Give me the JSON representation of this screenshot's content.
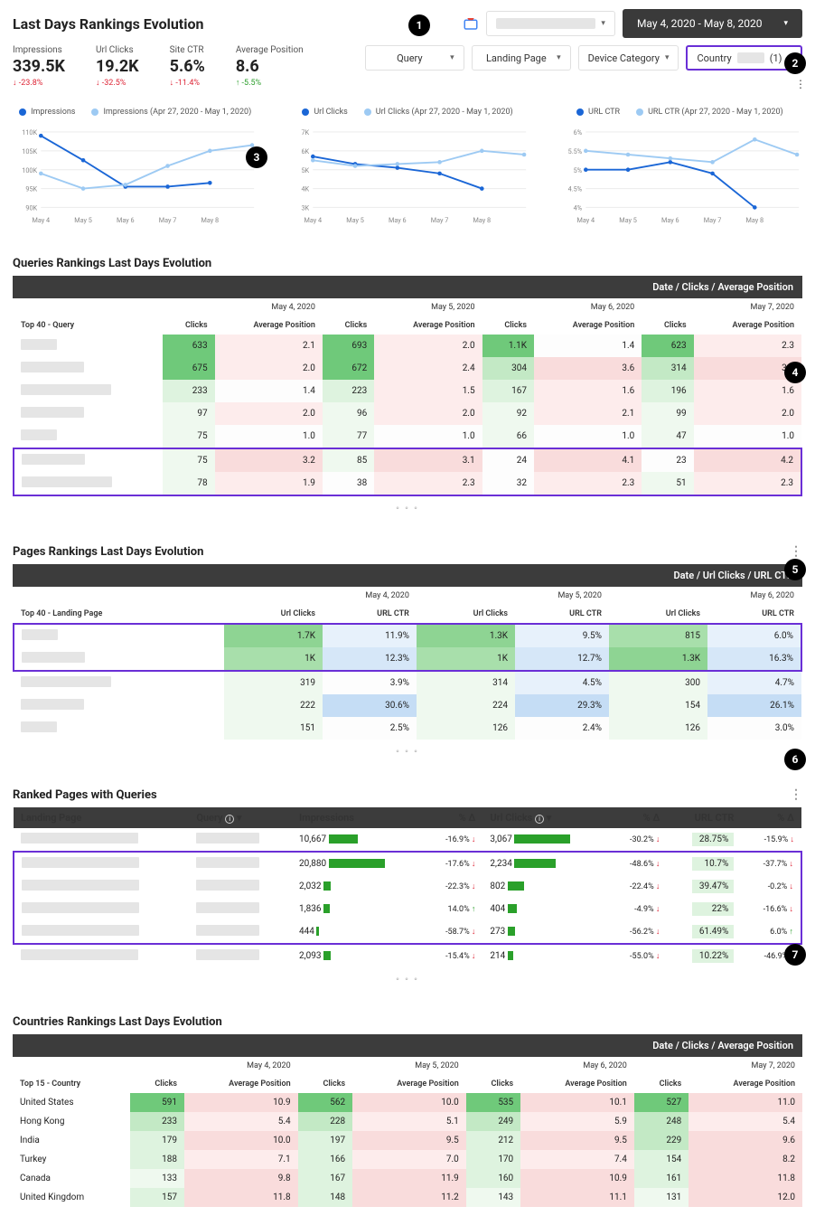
{
  "title": "Last Days Rankings Evolution",
  "dateRange": "May 4, 2020 - May 8, 2020",
  "metrics": [
    {
      "label": "Impressions",
      "value": "339.5K",
      "delta": "-23.8%",
      "dir": "down"
    },
    {
      "label": "Url Clicks",
      "value": "19.2K",
      "delta": "-32.5%",
      "dir": "down"
    },
    {
      "label": "Site CTR",
      "value": "5.6%",
      "delta": "-11.4%",
      "dir": "down"
    },
    {
      "label": "Average Position",
      "value": "8.6",
      "delta": "-5.5%",
      "dir": "up"
    }
  ],
  "filters": {
    "query": "Query",
    "landing": "Landing Page",
    "device": "Device Category",
    "country": "Country",
    "countryCount": "(1)"
  },
  "chart_data": [
    {
      "type": "line",
      "series": [
        {
          "name": "Impressions",
          "color": "#1a66d6",
          "values": [
            109000,
            102500,
            95500,
            95500,
            96500,
            null
          ]
        },
        {
          "name": "Impressions (Apr 27, 2020 - May 1, 2020)",
          "color": "#9dcaf3",
          "values": [
            99000,
            95000,
            96000,
            101000,
            105000,
            106500
          ]
        }
      ],
      "categories": [
        "May 4",
        "May 5",
        "May 6",
        "May 7",
        "May 8",
        ""
      ],
      "ylim": [
        90000,
        110000
      ],
      "yticks": [
        "90K",
        "95K",
        "100K",
        "105K",
        "110K"
      ]
    },
    {
      "type": "line",
      "series": [
        {
          "name": "Url Clicks",
          "color": "#1a66d6",
          "values": [
            5700,
            5300,
            5100,
            4800,
            4000,
            null
          ]
        },
        {
          "name": "Url Clicks (Apr 27, 2020 - May 1, 2020)",
          "color": "#9dcaf3",
          "values": [
            5500,
            5200,
            5300,
            5400,
            6000,
            5800
          ]
        }
      ],
      "categories": [
        "May 4",
        "May 5",
        "May 6",
        "May 7",
        "May 8",
        ""
      ],
      "ylim": [
        3000,
        7000
      ],
      "yticks": [
        "3K",
        "4K",
        "5K",
        "6K",
        "7K"
      ]
    },
    {
      "type": "line",
      "series": [
        {
          "name": "URL CTR",
          "color": "#1a66d6",
          "values": [
            5.0,
            5.0,
            5.2,
            4.9,
            4.0,
            null
          ]
        },
        {
          "name": "URL CTR (Apr 27, 2020 - May 1, 2020)",
          "color": "#9dcaf3",
          "values": [
            5.5,
            5.4,
            5.3,
            5.2,
            5.8,
            5.4
          ]
        }
      ],
      "categories": [
        "May 4",
        "May 5",
        "May 6",
        "May 7",
        "May 8",
        ""
      ],
      "ylim": [
        4,
        6
      ],
      "yticks": [
        "4%",
        "4.5%",
        "5%",
        "5.5%",
        "6%"
      ]
    }
  ],
  "queriesSection": {
    "title": "Queries Rankings Last Days Evolution",
    "band": "Date / Clicks / Average Position",
    "dates": [
      "May 4, 2020",
      "May 5, 2020",
      "May 6, 2020",
      "May 7, 2020"
    ],
    "rowlabel": "Top 40 - Query",
    "cols": [
      "Clicks",
      "Average Position"
    ],
    "rows": [
      {
        "c": [
          {
            "v": "633",
            "cls": "cell-g1"
          },
          {
            "v": "2.1",
            "cls": "cell-r1"
          },
          {
            "v": "693",
            "cls": "cell-g1"
          },
          {
            "v": "2.0",
            "cls": "cell-r1"
          },
          {
            "v": "1.1K",
            "cls": "cell-g1"
          },
          {
            "v": "1.4",
            "cls": "cell-w"
          },
          {
            "v": "623",
            "cls": "cell-g1"
          },
          {
            "v": "2.3",
            "cls": "cell-r1"
          }
        ]
      },
      {
        "c": [
          {
            "v": "675",
            "cls": "cell-g1"
          },
          {
            "v": "2.0",
            "cls": "cell-r1"
          },
          {
            "v": "672",
            "cls": "cell-g1"
          },
          {
            "v": "2.4",
            "cls": "cell-r1"
          },
          {
            "v": "304",
            "cls": "cell-g4"
          },
          {
            "v": "3.6",
            "cls": "cell-r2"
          },
          {
            "v": "314",
            "cls": "cell-g4"
          },
          {
            "v": "3.5",
            "cls": "cell-r2"
          }
        ]
      },
      {
        "c": [
          {
            "v": "233",
            "cls": "cell-g5"
          },
          {
            "v": "1.4",
            "cls": "cell-w"
          },
          {
            "v": "223",
            "cls": "cell-g5"
          },
          {
            "v": "1.5",
            "cls": "cell-r1"
          },
          {
            "v": "167",
            "cls": "cell-g5"
          },
          {
            "v": "1.6",
            "cls": "cell-r1"
          },
          {
            "v": "196",
            "cls": "cell-g5"
          },
          {
            "v": "1.6",
            "cls": "cell-r1"
          }
        ]
      },
      {
        "c": [
          {
            "v": "97",
            "cls": "cell-g6"
          },
          {
            "v": "2.0",
            "cls": "cell-r1"
          },
          {
            "v": "96",
            "cls": "cell-g6"
          },
          {
            "v": "2.0",
            "cls": "cell-r1"
          },
          {
            "v": "92",
            "cls": "cell-g6"
          },
          {
            "v": "2.1",
            "cls": "cell-r1"
          },
          {
            "v": "99",
            "cls": "cell-g6"
          },
          {
            "v": "2.0",
            "cls": "cell-r1"
          }
        ]
      },
      {
        "c": [
          {
            "v": "75",
            "cls": "cell-g6"
          },
          {
            "v": "1.0",
            "cls": "cell-w"
          },
          {
            "v": "77",
            "cls": "cell-g6"
          },
          {
            "v": "1.0",
            "cls": "cell-w"
          },
          {
            "v": "66",
            "cls": "cell-g6"
          },
          {
            "v": "1.0",
            "cls": "cell-w"
          },
          {
            "v": "47",
            "cls": "cell-g6"
          },
          {
            "v": "1.0",
            "cls": "cell-w"
          }
        ]
      },
      {
        "hl": true,
        "c": [
          {
            "v": "75",
            "cls": "cell-g6"
          },
          {
            "v": "3.2",
            "cls": "cell-r2"
          },
          {
            "v": "85",
            "cls": "cell-g6"
          },
          {
            "v": "3.1",
            "cls": "cell-r2"
          },
          {
            "v": "24",
            "cls": "cell-w"
          },
          {
            "v": "4.1",
            "cls": "cell-r2"
          },
          {
            "v": "23",
            "cls": "cell-w"
          },
          {
            "v": "4.2",
            "cls": "cell-r2"
          }
        ]
      },
      {
        "hl": true,
        "c": [
          {
            "v": "78",
            "cls": "cell-g6"
          },
          {
            "v": "1.9",
            "cls": "cell-r1"
          },
          {
            "v": "38",
            "cls": "cell-w"
          },
          {
            "v": "2.3",
            "cls": "cell-r1"
          },
          {
            "v": "32",
            "cls": "cell-w"
          },
          {
            "v": "2.3",
            "cls": "cell-r1"
          },
          {
            "v": "51",
            "cls": "cell-g6"
          },
          {
            "v": "2.3",
            "cls": "cell-r1"
          }
        ]
      }
    ]
  },
  "pagesSection": {
    "title": "Pages Rankings Last Days Evolution",
    "band": "Date / Url Clicks / URL CTR",
    "dates": [
      "May 4, 2020",
      "May 5, 2020",
      "May 6, 2020"
    ],
    "rowlabel": "Top 40 - Landing Page",
    "cols": [
      "Url Clicks",
      "URL CTR"
    ],
    "rows": [
      {
        "hl": true,
        "c": [
          {
            "v": "1.7K",
            "cls": "cell-g2"
          },
          {
            "v": "11.9%",
            "cls": "cell-b1"
          },
          {
            "v": "1.3K",
            "cls": "cell-g2"
          },
          {
            "v": "9.5%",
            "cls": "cell-b1"
          },
          {
            "v": "815",
            "cls": "cell-g3"
          },
          {
            "v": "6.0%",
            "cls": "cell-b1"
          }
        ]
      },
      {
        "hl": true,
        "c": [
          {
            "v": "1K",
            "cls": "cell-g3"
          },
          {
            "v": "12.3%",
            "cls": "cell-b2"
          },
          {
            "v": "1K",
            "cls": "cell-g3"
          },
          {
            "v": "12.7%",
            "cls": "cell-b2"
          },
          {
            "v": "1.3K",
            "cls": "cell-g2"
          },
          {
            "v": "16.3%",
            "cls": "cell-b2"
          }
        ]
      },
      {
        "c": [
          {
            "v": "319",
            "cls": "cell-g6"
          },
          {
            "v": "3.9%",
            "cls": "cell-w"
          },
          {
            "v": "314",
            "cls": "cell-g6"
          },
          {
            "v": "4.5%",
            "cls": "cell-b1"
          },
          {
            "v": "300",
            "cls": "cell-g6"
          },
          {
            "v": "4.7%",
            "cls": "cell-b1"
          }
        ]
      },
      {
        "c": [
          {
            "v": "222",
            "cls": "cell-g6"
          },
          {
            "v": "30.6%",
            "cls": "cell-b3"
          },
          {
            "v": "224",
            "cls": "cell-g6"
          },
          {
            "v": "29.3%",
            "cls": "cell-b3"
          },
          {
            "v": "154",
            "cls": "cell-g6"
          },
          {
            "v": "26.1%",
            "cls": "cell-b3"
          }
        ]
      },
      {
        "c": [
          {
            "v": "151",
            "cls": "cell-g6"
          },
          {
            "v": "2.5%",
            "cls": "cell-w"
          },
          {
            "v": "126",
            "cls": "cell-g6"
          },
          {
            "v": "2.4%",
            "cls": "cell-w"
          },
          {
            "v": "126",
            "cls": "cell-g6"
          },
          {
            "v": "3.0%",
            "cls": "cell-w"
          }
        ]
      }
    ]
  },
  "rankedSection": {
    "title": "Ranked Pages with Queries",
    "headers": {
      "lp": "Landing Page",
      "q": "Query",
      "imp": "Impressions",
      "pd": "% Δ",
      "uc": "Url Clicks",
      "pd2": "% Δ",
      "ctr": "URL CTR",
      "pd3": "% Δ"
    },
    "rows": [
      {
        "imp": "10,667",
        "impBar": 32,
        "impPct": "-16.9%",
        "impDir": "down",
        "uc": "3,067",
        "ucBar": 62,
        "ucPct": "-30.2%",
        "ucDir": "down",
        "ctr": "28.75%",
        "ctrCls": "cell-g3",
        "ctrPct": "-15.9%",
        "ctrDir": "down"
      },
      {
        "hl": true,
        "imp": "20,880",
        "impBar": 62,
        "impPct": "-17.6%",
        "impDir": "down",
        "uc": "2,234",
        "ucBar": 46,
        "ucPct": "-48.6%",
        "ucDir": "down",
        "ctr": "10.7%",
        "ctrCls": "cell-g5",
        "ctrPct": "-37.7%",
        "ctrDir": "down"
      },
      {
        "hl": true,
        "imp": "2,032",
        "impBar": 8,
        "impPct": "-22.3%",
        "impDir": "down",
        "uc": "802",
        "ucBar": 18,
        "ucPct": "-22.4%",
        "ucDir": "down",
        "ctr": "39.47%",
        "ctrCls": "cell-g2",
        "ctrPct": "-0.2%",
        "ctrDir": "down"
      },
      {
        "hl": true,
        "imp": "1,836",
        "impBar": 7,
        "impPct": "14.0%",
        "impDir": "up",
        "uc": "404",
        "ucBar": 10,
        "ucPct": "-4.9%",
        "ucDir": "down",
        "ctr": "22%",
        "ctrCls": "cell-g4",
        "ctrPct": "-16.6%",
        "ctrDir": "down"
      },
      {
        "hl": true,
        "imp": "444",
        "impBar": 3,
        "impPct": "-58.7%",
        "impDir": "down",
        "uc": "273",
        "ucBar": 8,
        "ucPct": "-56.2%",
        "ucDir": "down",
        "ctr": "61.49%",
        "ctrCls": "cell-g1",
        "ctrPct": "6.0%",
        "ctrDir": "up"
      },
      {
        "imp": "2,093",
        "impBar": 8,
        "impPct": "-15.4%",
        "impDir": "down",
        "uc": "214",
        "ucBar": 6,
        "ucPct": "-55.0%",
        "ucDir": "down",
        "ctr": "10.22%",
        "ctrCls": "cell-g5",
        "ctrPct": "-46.9%",
        "ctrDir": "down"
      }
    ]
  },
  "countriesSection": {
    "title": "Countries Rankings Last Days Evolution",
    "band": "Date / Clicks / Average Position",
    "dates": [
      "May 4, 2020",
      "May 5, 2020",
      "May 6, 2020",
      "May 7, 2020"
    ],
    "rowlabel": "Top 15 - Country",
    "cols": [
      "Clicks",
      "Average Position"
    ],
    "rows": [
      {
        "name": "United States",
        "c": [
          {
            "v": "591",
            "cls": "cell-g1"
          },
          {
            "v": "10.9",
            "cls": "cell-r2"
          },
          {
            "v": "562",
            "cls": "cell-g1"
          },
          {
            "v": "10.0",
            "cls": "cell-r2"
          },
          {
            "v": "535",
            "cls": "cell-g1"
          },
          {
            "v": "10.1",
            "cls": "cell-r2"
          },
          {
            "v": "527",
            "cls": "cell-g1"
          },
          {
            "v": "11.0",
            "cls": "cell-r2"
          }
        ]
      },
      {
        "name": "Hong Kong",
        "c": [
          {
            "v": "233",
            "cls": "cell-g4"
          },
          {
            "v": "5.4",
            "cls": "cell-r1"
          },
          {
            "v": "228",
            "cls": "cell-g4"
          },
          {
            "v": "5.1",
            "cls": "cell-r1"
          },
          {
            "v": "249",
            "cls": "cell-g4"
          },
          {
            "v": "5.9",
            "cls": "cell-r1"
          },
          {
            "v": "248",
            "cls": "cell-g4"
          },
          {
            "v": "5.4",
            "cls": "cell-r1"
          }
        ]
      },
      {
        "name": "India",
        "c": [
          {
            "v": "179",
            "cls": "cell-g5"
          },
          {
            "v": "10.0",
            "cls": "cell-r2"
          },
          {
            "v": "197",
            "cls": "cell-g5"
          },
          {
            "v": "9.5",
            "cls": "cell-r2"
          },
          {
            "v": "212",
            "cls": "cell-g5"
          },
          {
            "v": "9.5",
            "cls": "cell-r2"
          },
          {
            "v": "229",
            "cls": "cell-g4"
          },
          {
            "v": "9.6",
            "cls": "cell-r2"
          }
        ]
      },
      {
        "name": "Turkey",
        "c": [
          {
            "v": "188",
            "cls": "cell-g5"
          },
          {
            "v": "7.1",
            "cls": "cell-r1"
          },
          {
            "v": "166",
            "cls": "cell-g5"
          },
          {
            "v": "7.0",
            "cls": "cell-r1"
          },
          {
            "v": "170",
            "cls": "cell-g5"
          },
          {
            "v": "7.4",
            "cls": "cell-r1"
          },
          {
            "v": "154",
            "cls": "cell-g5"
          },
          {
            "v": "8.2",
            "cls": "cell-r2"
          }
        ]
      },
      {
        "name": "Canada",
        "c": [
          {
            "v": "133",
            "cls": "cell-g6"
          },
          {
            "v": "9.8",
            "cls": "cell-r2"
          },
          {
            "v": "167",
            "cls": "cell-g5"
          },
          {
            "v": "11.9",
            "cls": "cell-r2"
          },
          {
            "v": "160",
            "cls": "cell-g5"
          },
          {
            "v": "10.9",
            "cls": "cell-r2"
          },
          {
            "v": "161",
            "cls": "cell-g5"
          },
          {
            "v": "11.8",
            "cls": "cell-r2"
          }
        ]
      },
      {
        "name": "United Kingdom",
        "c": [
          {
            "v": "157",
            "cls": "cell-g5"
          },
          {
            "v": "11.8",
            "cls": "cell-r2"
          },
          {
            "v": "148",
            "cls": "cell-g5"
          },
          {
            "v": "11.2",
            "cls": "cell-r2"
          },
          {
            "v": "143",
            "cls": "cell-g6"
          },
          {
            "v": "11.1",
            "cls": "cell-r2"
          },
          {
            "v": "131",
            "cls": "cell-g6"
          },
          {
            "v": "12.0",
            "cls": "cell-r2"
          }
        ]
      }
    ]
  },
  "pager": "◦ ◦ ◦"
}
